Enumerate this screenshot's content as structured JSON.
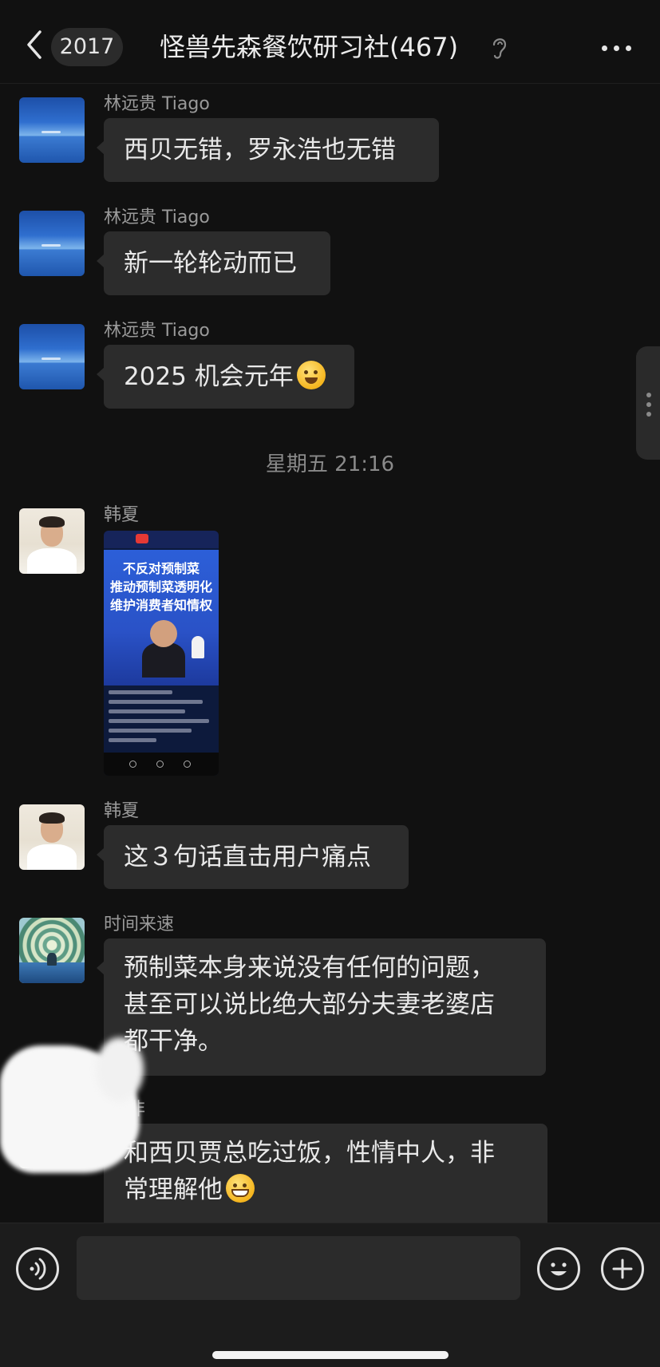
{
  "header": {
    "unread_count": "2017",
    "title": "怪兽先森餐饮研习社(467)",
    "icons": {
      "back": "chevron-left-icon",
      "ear": "ear-icon",
      "more": "more-icon"
    }
  },
  "messages": [
    {
      "sender": "林远贵 Tiago",
      "text": "西贝无错，罗永浩也无错"
    },
    {
      "sender": "林远贵 Tiago",
      "text": "新一轮轮动而已"
    },
    {
      "sender": "林远贵 Tiago",
      "text": "2025 机会元年"
    },
    {
      "sender": "韩夏",
      "image": "live-stream-screenshot"
    },
    {
      "sender": "韩夏",
      "text": "这３句话直击用户痛点"
    },
    {
      "sender": "时间来速",
      "text_lines": [
        "预制菜本身来说没有任何的问题，",
        "甚至可以说比绝大部分夫妻老婆店",
        "都干净。"
      ]
    },
    {
      "sender": "非",
      "text_lines": [
        "和西贝贾总吃过饭，性情中人，非",
        "常理解他"
      ]
    }
  ],
  "timestamp": "星期五 21:16",
  "shared_image": {
    "headline_lines": [
      "不反对预制菜",
      "推动预制菜透明化",
      "维护消费者知情权"
    ]
  },
  "input_bar": {
    "placeholder": "",
    "icons": {
      "voice": "voice-icon",
      "emoji": "emoji-icon",
      "plus": "plus-icon"
    }
  },
  "colors": {
    "background": "#111111",
    "bubble": "#2c2c2c",
    "sender_text": "#9a9a9a",
    "message_text": "#e9e9e9"
  }
}
